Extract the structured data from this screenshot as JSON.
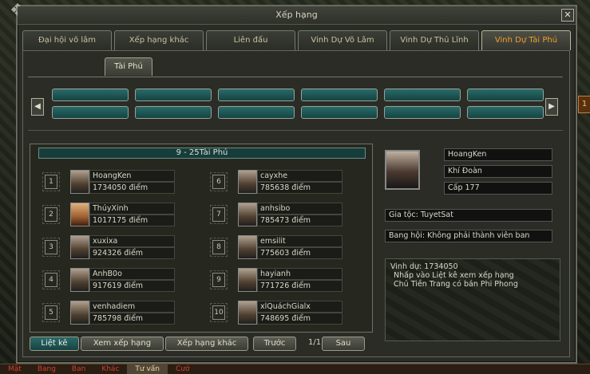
{
  "window": {
    "title": "Xếp hạng",
    "close": "✕"
  },
  "tabs": [
    {
      "label": "Đại hội võ lâm",
      "active": false
    },
    {
      "label": "Xếp hạng khác",
      "active": false
    },
    {
      "label": "Liên đấu",
      "active": false
    },
    {
      "label": "Vinh Dự Võ Lâm",
      "active": false
    },
    {
      "label": "Vinh Dự Thủ Lĩnh",
      "active": false
    },
    {
      "label": "Vinh Dự Tài Phú",
      "active": true
    }
  ],
  "subtab": {
    "label": "Tài Phú"
  },
  "nav": {
    "prev": "◀",
    "next": "▶"
  },
  "ranking": {
    "header": "9 - 25Tài Phú",
    "entries": [
      {
        "rank": "1",
        "name": "HoangKen",
        "score": "1734050 điểm"
      },
      {
        "rank": "2",
        "name": "ThúyXinh",
        "score": "1017175 điểm"
      },
      {
        "rank": "3",
        "name": "xuxixa",
        "score": "924326 điểm"
      },
      {
        "rank": "4",
        "name": "AnhB0o",
        "score": "917619 điểm"
      },
      {
        "rank": "5",
        "name": "venhadiem",
        "score": "785798 điểm"
      },
      {
        "rank": "6",
        "name": "cayxhe",
        "score": "785638 điểm"
      },
      {
        "rank": "7",
        "name": "anhsibo",
        "score": "785473 điểm"
      },
      {
        "rank": "8",
        "name": "emsilit",
        "score": "775603 điểm"
      },
      {
        "rank": "9",
        "name": "hayianh",
        "score": "771726 điểm"
      },
      {
        "rank": "10",
        "name": "xlQuáchGialx",
        "score": "748695 điểm"
      }
    ]
  },
  "selected": {
    "name": "HoangKen",
    "title": "Khí Đoàn",
    "level": "Cấp 177",
    "family": "Gia tộc: TuyetSat",
    "guild": "Bang hội: Không phải thành viên ban",
    "honor": "Vinh dự: 1734050",
    "hint1": "Nhấp vào Liệt kê xem xếp hạng",
    "hint2": "Chủ Tiền Trang có bán Phi Phong"
  },
  "buttons": {
    "list": "Liệt kê",
    "view_rank": "Xem xếp hạng",
    "other_rank": "Xếp hạng khác",
    "prev": "Trước",
    "page": "1/1",
    "next": "Sau"
  },
  "bottombar": [
    "Mật",
    "Bang",
    "Ban",
    "Khác",
    "Tư vấn",
    "Cướ"
  ],
  "side_chip": "1"
}
